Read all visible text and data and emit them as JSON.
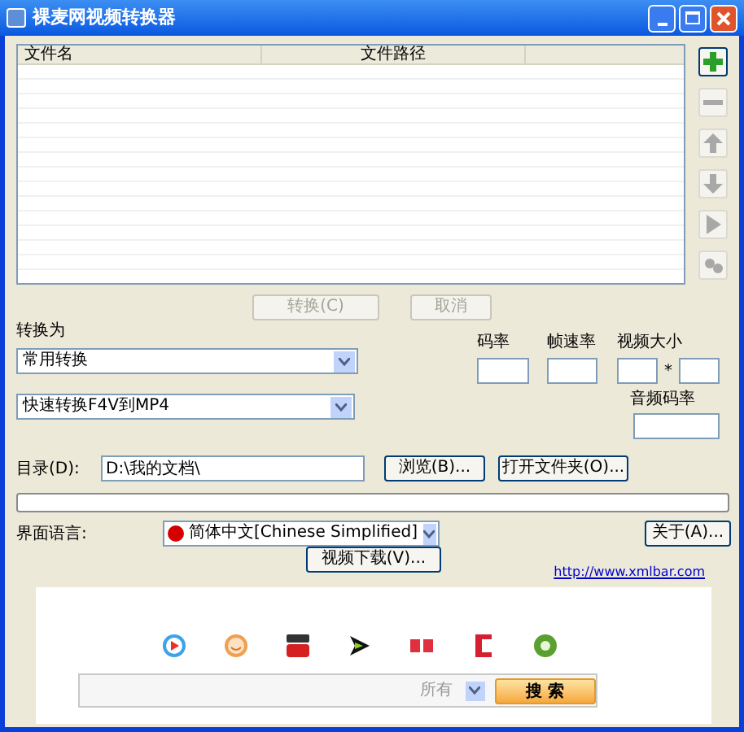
{
  "window": {
    "title": "裸麦网视频转换器"
  },
  "file_list": {
    "columns": [
      "文件名",
      "文件路径"
    ]
  },
  "side_tools": [
    {
      "kind": "add",
      "disabled": false
    },
    {
      "kind": "remove",
      "disabled": true
    },
    {
      "kind": "up",
      "disabled": true
    },
    {
      "kind": "down",
      "disabled": true
    },
    {
      "kind": "play",
      "disabled": true
    },
    {
      "kind": "settings",
      "disabled": true
    }
  ],
  "actions": [
    {
      "label": "转换(C)",
      "disabled": true
    },
    {
      "label": "取消",
      "disabled": true
    }
  ],
  "convert_to": {
    "label": "转换为",
    "category": "常用转换",
    "preset": "快速转换F4V到MP4"
  },
  "params": {
    "bitrate_label": "码率",
    "framerate_label": "帧速率",
    "size_label": "视频大小",
    "size_separator": "*",
    "audio_label": "音频码率"
  },
  "directory": {
    "label": "目录(D):",
    "value": "D:\\我的文档\\",
    "browse": "浏览(B)...",
    "open_folder": "打开文件夹(O)..."
  },
  "progress": {
    "level": 0
  },
  "language": {
    "label": "界面语言:",
    "value": "简体中文[Chinese Simplified]",
    "about": "关于(A)..."
  },
  "download_button": "视频下载(V)...",
  "link": "http://www.xmlbar.com",
  "search": {
    "sites": [
      {
        "kind": "play"
      },
      {
        "kind": "smile"
      },
      {
        "kind": "tube"
      },
      {
        "kind": "arrow"
      },
      {
        "kind": "fifty"
      },
      {
        "kind": "bracket"
      },
      {
        "kind": "swirl"
      }
    ],
    "scope": "所有",
    "button": "搜 索"
  }
}
